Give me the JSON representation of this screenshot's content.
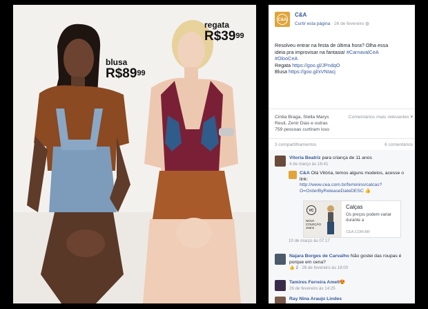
{
  "photo": {
    "left_product": {
      "label": "blusa",
      "currency": "R$",
      "whole": "89",
      "cents": "99"
    },
    "right_product": {
      "label": "regata",
      "currency": "R$",
      "whole": "39",
      "cents": "99"
    }
  },
  "post": {
    "page_name": "C&A",
    "logo_text": "C&A",
    "like_link": "Curtir esta página",
    "date": "26 de fevereiro",
    "privacy_icon": "globe-icon",
    "text_line_1": "Resolveu entrar na festa de última hora? Olha essa",
    "text_line_2": "ideia pra improvisar na fantasia!",
    "hashtag_1": "#CarnavalCeA",
    "hashtag_2": "#OlooCeA",
    "regata_label": "Regata",
    "regata_url": "https://goo.gl/JPndqO",
    "blusa_label": "Blusa",
    "blusa_url": "https://goo.gl/xVNIacj"
  },
  "reactions": {
    "names": "Cintia Braga, Stella Marys",
    "names_2": "Reuli, Zenir Dias e outras",
    "likes": "759 pessoas curtiram isso",
    "sort_label": "Comentários mais relevantes",
    "shares": "3 compartilhamentos",
    "comments_count": "6 comentários"
  },
  "comments": [
    {
      "name": "Vitoria Beatriz",
      "text": "para criança de 11 anos",
      "meta": "4 de março às 16:41"
    },
    {
      "name": "C&A",
      "text": "Olá Vitória, temos alguns modelos, acesse o link:",
      "link": "http://www.cea.com.br/feminino/calcas?",
      "link2": "O=OrderByReleaseDateDESC"
    },
    {
      "name": "Najara Borges de Carvalho",
      "text": "Não gostei das roupas é porque em cena?",
      "likes": "2",
      "meta": "26 de fevereiro às 18:00"
    },
    {
      "name": "Tamires Ferreira Amell",
      "text": "",
      "meta": "26 de fevereiro às 14:25"
    },
    {
      "name": "Ray Nina Araujo Lindes",
      "text": "",
      "meta": ""
    }
  ],
  "link_card": {
    "logo": "VC",
    "brand_line": "NOVA COLEÇÃO Jeans",
    "title": "Calças",
    "description": "Os preços podem variar durante a",
    "domain": "CEA.COM.BR",
    "meta": "10 de março às 07:17"
  },
  "colors": {
    "brand": "#e0a53a",
    "link": "#365899"
  }
}
